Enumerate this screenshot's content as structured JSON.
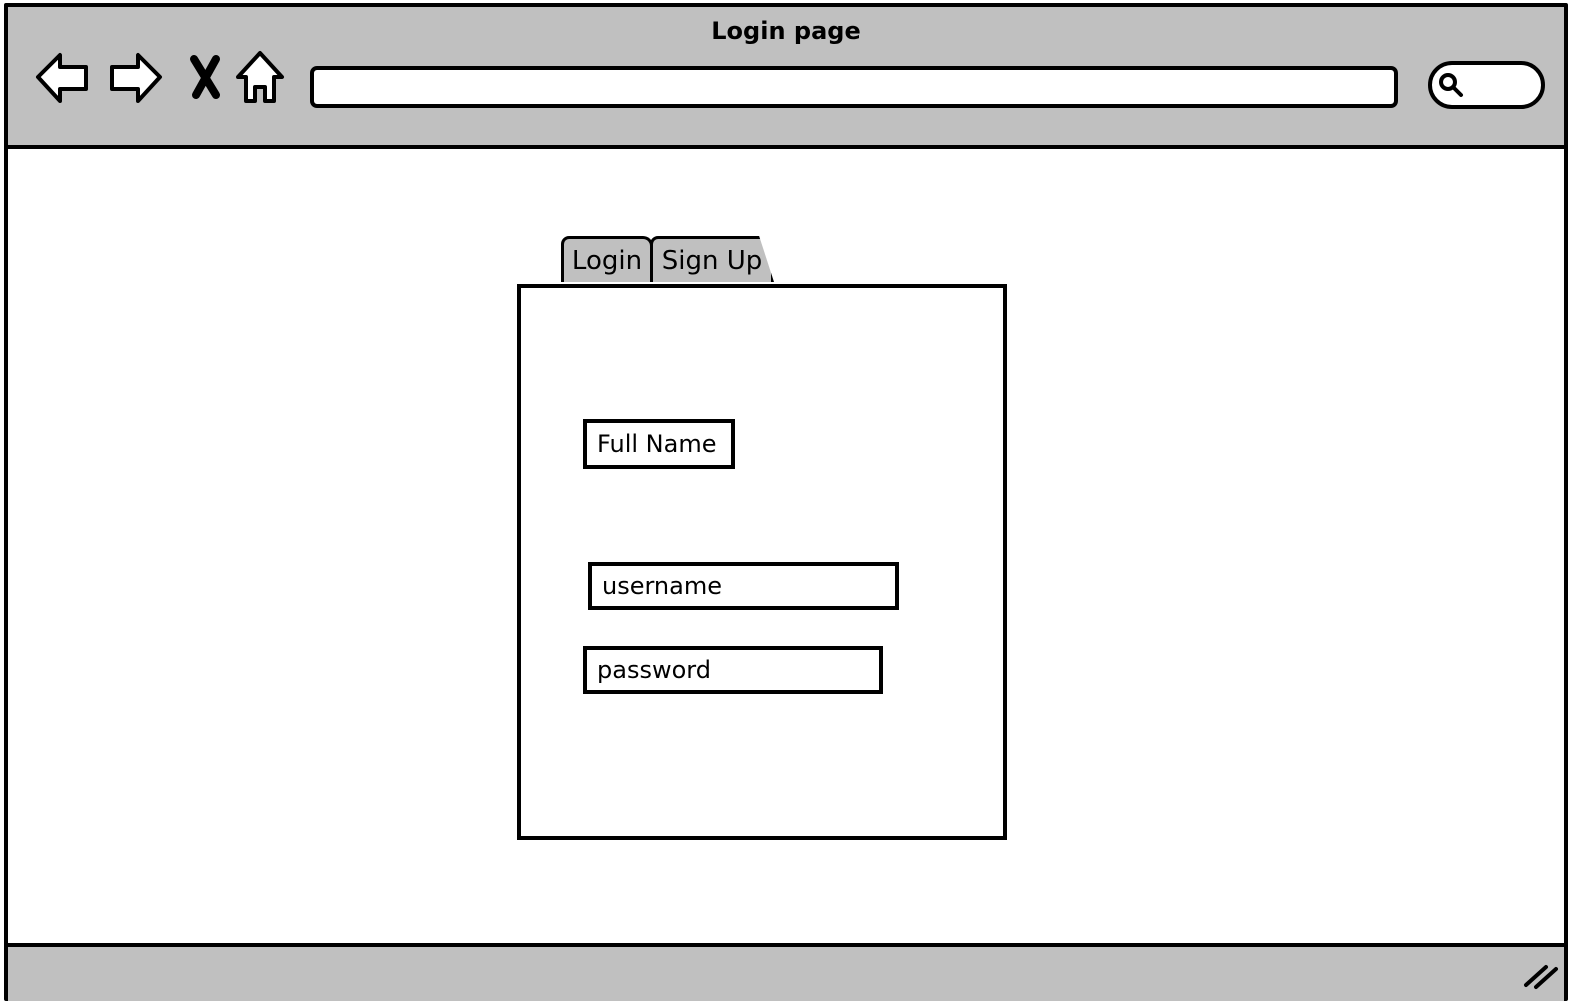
{
  "window": {
    "title": "Login page"
  },
  "toolbar": {
    "icons": [
      "back-arrow-icon",
      "forward-arrow-icon",
      "close-icon",
      "home-icon"
    ],
    "url": "",
    "search_icon": "search-icon"
  },
  "tabs": [
    {
      "label": "Login"
    },
    {
      "label": "Sign Up"
    }
  ],
  "form": {
    "fullname_label": "Full Name",
    "username_value": "username",
    "password_value": "password"
  },
  "colors": {
    "chrome": "#c0c0c0",
    "stroke": "#000000",
    "background": "#ffffff"
  }
}
